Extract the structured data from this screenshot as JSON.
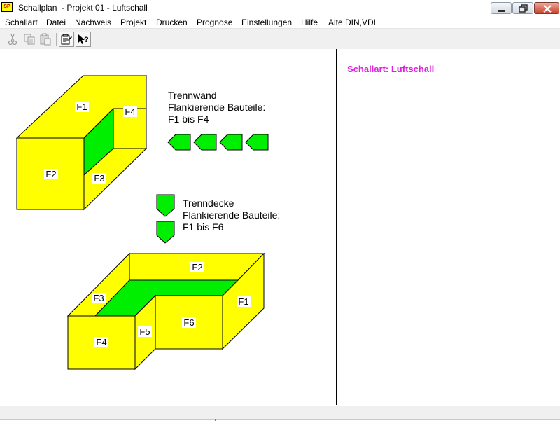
{
  "window": {
    "app_icon_text": "SP",
    "title": "Schallplan  - Projekt 01 - Luftschall"
  },
  "menu": {
    "items": [
      "Schallart",
      "Datei",
      "Nachweis",
      "Projekt",
      "Drucken",
      "Prognose",
      "Einstellungen",
      "Hilfe",
      "Alte DIN,VDI"
    ]
  },
  "toolbar": {
    "buttons": [
      "scissors-icon",
      "copy-icon",
      "paste-icon",
      "properties-icon",
      "context-help-icon"
    ]
  },
  "wall_diagram": {
    "labels": {
      "f1": "F1",
      "f2": "F2",
      "f3": "F3",
      "f4": "F4"
    },
    "description": [
      "Trennwand",
      "Flankierende Bauteile:",
      "F1 bis F4"
    ]
  },
  "floor_diagram": {
    "labels": {
      "f1": "F1",
      "f2": "F2",
      "f3": "F3",
      "f4": "F4",
      "f5": "F5",
      "f6": "F6"
    },
    "description": [
      "Trenndecke",
      "Flankierende Bauteile:",
      "F1 bis F6"
    ]
  },
  "info_pane": {
    "sound_type": "Schallart: Luftschall"
  },
  "colors": {
    "face_fill": "#ffff00",
    "partition_fill": "#00ee00",
    "info_text": "#e020e0"
  }
}
